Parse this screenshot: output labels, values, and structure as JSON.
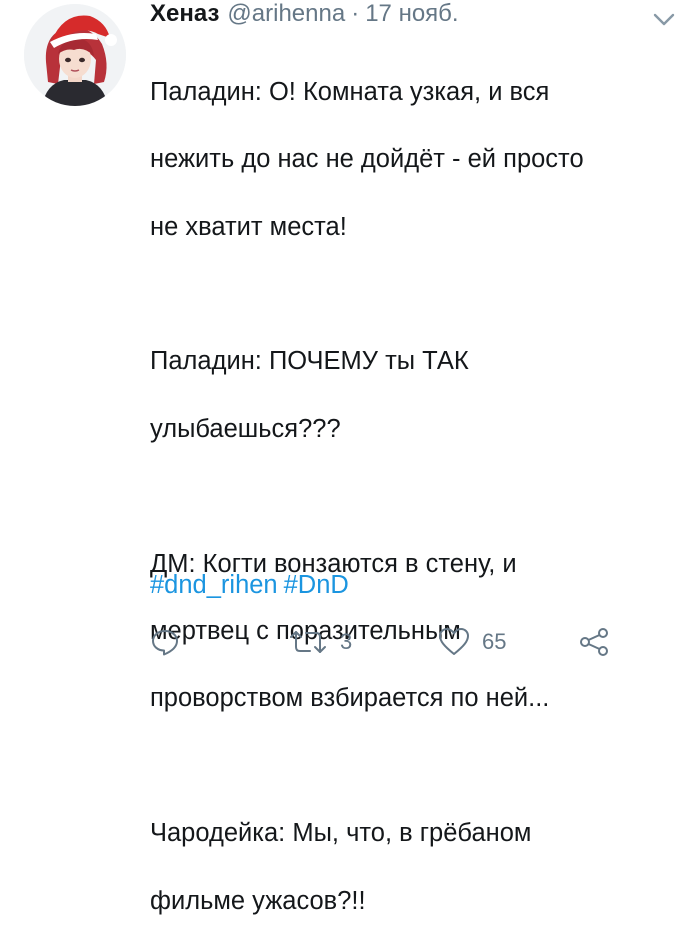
{
  "tweet": {
    "author_name": "Хеназ",
    "handle": "@arihenna",
    "separator": "·",
    "date": "17 нояб.",
    "lines": [
      "Паладин: О! Комната узкая, и вся",
      "нежить до нас не дойдёт - ей просто",
      "не хватит места!",
      "",
      "Паладин: ПОЧЕМУ ты ТАК",
      "улыбаешься???",
      "",
      "ДМ: Когти вонзаются в стену, и",
      "мертвец с поразительным",
      "проворством взбирается по ней...",
      "",
      "Чародейка: Мы, что, в грёбаном",
      "фильме ужасов?!!"
    ],
    "hashtags": [
      "#dnd_rihen",
      "#DnD"
    ]
  },
  "actions": {
    "reply": {
      "icon": "reply-icon",
      "count": ""
    },
    "retweet": {
      "icon": "retweet-icon",
      "count": "3"
    },
    "like": {
      "icon": "heart-icon",
      "count": "65"
    },
    "share": {
      "icon": "share-icon",
      "count": ""
    }
  },
  "colors": {
    "text": "#14171a",
    "secondary": "#657786",
    "link": "#1b95e0",
    "background": "#ffffff"
  }
}
